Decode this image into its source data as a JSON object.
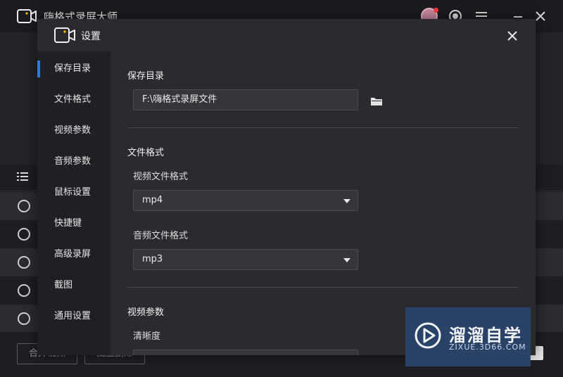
{
  "app": {
    "title": "嗨格式录屏大师",
    "bottom_buttons": [
      "合并视频",
      "批量删除"
    ]
  },
  "dialog": {
    "title": "设置",
    "nav": [
      {
        "label": "保存目录",
        "active": true
      },
      {
        "label": "文件格式",
        "active": false
      },
      {
        "label": "视频参数",
        "active": false
      },
      {
        "label": "音频参数",
        "active": false
      },
      {
        "label": "鼠标设置",
        "active": false
      },
      {
        "label": "快捷键",
        "active": false
      },
      {
        "label": "高级录屏",
        "active": false
      },
      {
        "label": "截图",
        "active": false
      },
      {
        "label": "通用设置",
        "active": false
      }
    ],
    "save_dir": {
      "section_title": "保存目录",
      "path": "F:\\嗨格式录屏文件"
    },
    "file_format": {
      "section_title": "文件格式",
      "video_label": "视频文件格式",
      "video_value": "mp4",
      "audio_label": "音频文件格式",
      "audio_value": "mp3"
    },
    "video_params": {
      "section_title": "视频参数",
      "clarity_label": "清晰度"
    }
  },
  "watermark": {
    "text": "溜溜自学",
    "url": "ZIXUE.3D66.COM"
  },
  "colors": {
    "accent": "#2f7bd6",
    "dialog_bg": "#2a2b2e",
    "sidebar_bg": "#1f2023",
    "field_bg": "#35363a"
  }
}
